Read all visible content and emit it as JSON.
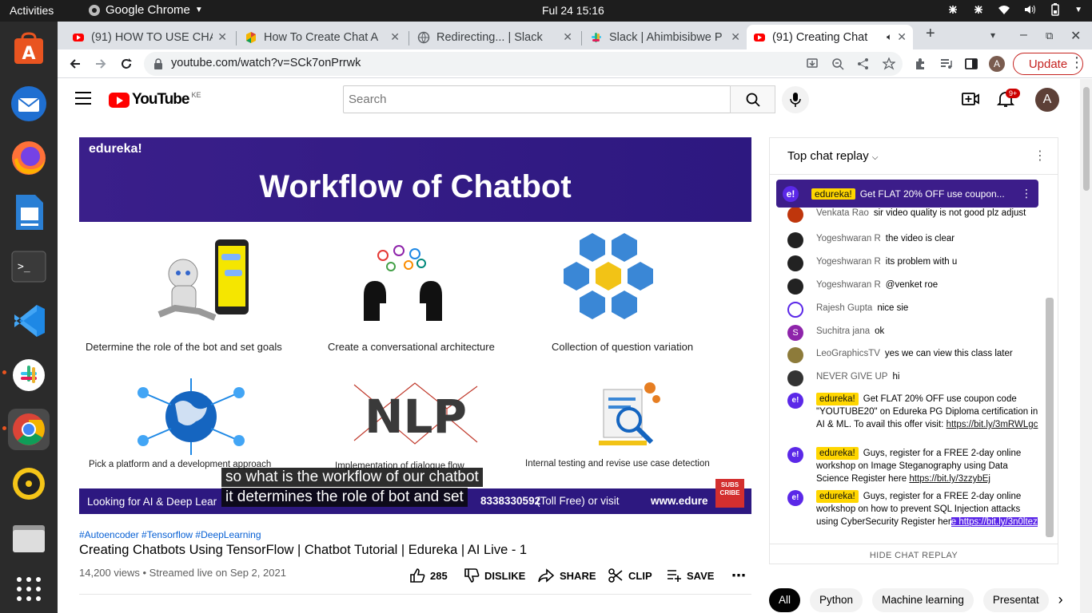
{
  "system": {
    "activities": "Activities",
    "app_name": "Google Chrome",
    "clock": "Ful 24  15:16"
  },
  "tabs": [
    {
      "title": "(91) HOW TO USE CHA",
      "icon": "youtube-icon"
    },
    {
      "title": "How To Create Chat A",
      "icon": "colorful-icon"
    },
    {
      "title": "Redirecting... | Slack",
      "icon": "globe-icon"
    },
    {
      "title": "Slack | Ahimbisibwe P",
      "icon": "slack-icon"
    },
    {
      "title": "(91) Creating Chat",
      "icon": "youtube-icon"
    }
  ],
  "omnibox": {
    "url": "youtube.com/watch?v=SCk7onPrrwk",
    "update_label": "Update",
    "profile_initial": "A"
  },
  "youtube": {
    "logo_text": "YouTube",
    "country_code": "KE",
    "search_placeholder": "Search",
    "notif_count": "9+",
    "avatar_initial": "A"
  },
  "slide": {
    "brand": "edureka!",
    "title": "Workflow of Chatbot",
    "captions": [
      "Determine the role of the bot and set goals",
      "Create a conversational architecture",
      "Collection of question variation",
      "Pick a platform and a development approach",
      "Implementation of dialogue flow",
      "Internal testing and revise  use case detection"
    ],
    "footer_text": "Looking for AI & Deep Lear",
    "footer_phone": "8338330592",
    "footer_toll": "(Toll Free) or visit",
    "footer_web": "www.edure",
    "subscribe": "SUBS CRIBE",
    "subtitle_line1": "so what is the workflow of our chatbot",
    "subtitle_line2": "it determines the role of bot and set"
  },
  "video": {
    "hashtags": "#Autoencoder #Tensorflow #DeepLearning",
    "title": "Creating Chatbots Using TensorFlow | Chatbot Tutorial | Edureka | AI Live - 1",
    "meta": "14,200 views • Streamed live on Sep 2, 2021",
    "likes": "285",
    "dislike": "DISLIKE",
    "share": "SHARE",
    "clip": "CLIP",
    "save": "SAVE"
  },
  "chat": {
    "header": "Top chat replay",
    "pinned_author": "edureka!",
    "pinned_text": "Get FLAT 20% OFF use coupon...",
    "partial_author": "Venkata Rao",
    "partial_text": "sir video quality is not good plz adjust",
    "messages": [
      {
        "author": "Yogeshwaran R",
        "text": "the video is clear",
        "color": "#222"
      },
      {
        "author": "Yogeshwaran R",
        "text": "its problem with u",
        "color": "#222"
      },
      {
        "author": "Yogeshwaran R",
        "text": "@venket roe",
        "color": "#222"
      },
      {
        "author": "Rajesh Gupta",
        "text": "nice sie",
        "color": "#ffffff"
      },
      {
        "author": "Suchitra jana",
        "text": "ok",
        "color": "#8e24aa"
      },
      {
        "author": "LeoGraphicsTV",
        "text": "yes we can view this class later",
        "color": "#8d7b3a"
      },
      {
        "author": "NEVER GIVE UP",
        "text": "hi",
        "color": "#333"
      }
    ],
    "edureka_messages": [
      {
        "author": "edureka!",
        "text": "Get FLAT 20% OFF use coupon code \"YOUTUBE20\" on Edureka PG Diploma certification in AI & ML. To avail this offer visit:",
        "link": "https://bit.ly/3mRWLgc"
      },
      {
        "author": "edureka!",
        "text": "Guys, register for a FREE 2-day online workshop on Image Steganography using Data Science Register here",
        "link": "https://bit.ly/3zzybEj"
      },
      {
        "author": "edureka!",
        "text": "Guys, register for a FREE 2-day online workshop on how to prevent SQL Injection attacks using CyberSecurity Register her",
        "link_hl": "e https://bit.ly/3n0ltez"
      }
    ],
    "footer": "HIDE CHAT REPLAY"
  },
  "chips": [
    "All",
    "Python",
    "Machine learning",
    "Presentat"
  ]
}
